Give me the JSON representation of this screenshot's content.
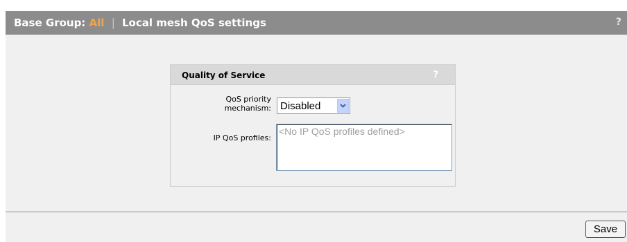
{
  "header": {
    "prefix": "Base Group:",
    "group_value": "All",
    "separator": "|",
    "page_title": "Local mesh QoS settings",
    "help": "?"
  },
  "qos_panel": {
    "title": "Quality of Service",
    "help": "?",
    "priority_label_line1": "QoS priority",
    "priority_label_line2": "mechanism:",
    "priority_value": "Disabled",
    "profiles_label": "IP QoS profiles:",
    "profiles_placeholder": "<No IP QoS profiles defined>"
  },
  "footer": {
    "save_label": "Save"
  },
  "colors": {
    "header_bg": "#8c8c8c",
    "accent": "#f2a34b",
    "content_bg": "#f0f0f0",
    "panel_header_bg": "#d9d9d9"
  }
}
